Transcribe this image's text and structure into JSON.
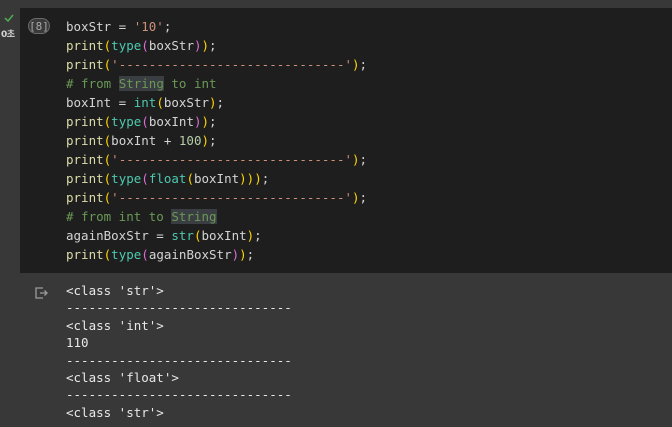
{
  "gutter": {
    "status_icon": "check-icon",
    "exec_time": "0초"
  },
  "cell": {
    "exec_count": "[8]"
  },
  "code_tokens": [
    [
      {
        "t": "boxStr = "
      },
      {
        "t": "'10'",
        "c": "tok-str"
      },
      {
        "t": ";"
      }
    ],
    [
      {
        "t": "print",
        "c": "tok-fn"
      },
      {
        "t": "(",
        "c": "tok-punc"
      },
      {
        "t": "type",
        "c": "tok-builtin"
      },
      {
        "t": "(",
        "c": "tok-punc2"
      },
      {
        "t": "boxStr"
      },
      {
        "t": ")",
        "c": "tok-punc2"
      },
      {
        "t": ")",
        "c": "tok-punc"
      },
      {
        "t": ";"
      }
    ],
    [
      {
        "t": "print",
        "c": "tok-fn"
      },
      {
        "t": "(",
        "c": "tok-punc"
      },
      {
        "t": "'------------------------------'",
        "c": "tok-str"
      },
      {
        "t": ")",
        "c": "tok-punc"
      },
      {
        "t": ";"
      }
    ],
    [
      {
        "t": "# from ",
        "c": "tok-comment"
      },
      {
        "t": "String",
        "c": "tok-comment tok-hl"
      },
      {
        "t": " to int",
        "c": "tok-comment"
      }
    ],
    [
      {
        "t": "boxInt = "
      },
      {
        "t": "int",
        "c": "tok-builtin"
      },
      {
        "t": "(",
        "c": "tok-punc"
      },
      {
        "t": "boxStr"
      },
      {
        "t": ")",
        "c": "tok-punc"
      },
      {
        "t": ";"
      }
    ],
    [
      {
        "t": "print",
        "c": "tok-fn"
      },
      {
        "t": "(",
        "c": "tok-punc"
      },
      {
        "t": "type",
        "c": "tok-builtin"
      },
      {
        "t": "(",
        "c": "tok-punc2"
      },
      {
        "t": "boxInt"
      },
      {
        "t": ")",
        "c": "tok-punc2"
      },
      {
        "t": ")",
        "c": "tok-punc"
      },
      {
        "t": ";"
      }
    ],
    [
      {
        "t": "print",
        "c": "tok-fn"
      },
      {
        "t": "(",
        "c": "tok-punc"
      },
      {
        "t": "boxInt + "
      },
      {
        "t": "100",
        "c": "tok-num"
      },
      {
        "t": ")",
        "c": "tok-punc"
      },
      {
        "t": ";"
      }
    ],
    [
      {
        "t": "print",
        "c": "tok-fn"
      },
      {
        "t": "(",
        "c": "tok-punc"
      },
      {
        "t": "'------------------------------'",
        "c": "tok-str"
      },
      {
        "t": ")",
        "c": "tok-punc"
      },
      {
        "t": ";"
      }
    ],
    [
      {
        "t": "print",
        "c": "tok-fn"
      },
      {
        "t": "(",
        "c": "tok-punc"
      },
      {
        "t": "type",
        "c": "tok-builtin"
      },
      {
        "t": "(",
        "c": "tok-punc2"
      },
      {
        "t": "float",
        "c": "tok-builtin"
      },
      {
        "t": "(",
        "c": "tok-punc"
      },
      {
        "t": "boxInt"
      },
      {
        "t": ")))",
        "c": "tok-punc"
      },
      {
        "t": ";"
      }
    ],
    [
      {
        "t": "print",
        "c": "tok-fn"
      },
      {
        "t": "(",
        "c": "tok-punc"
      },
      {
        "t": "'------------------------------'",
        "c": "tok-str"
      },
      {
        "t": ")",
        "c": "tok-punc"
      },
      {
        "t": ";"
      }
    ],
    [
      {
        "t": "# from int to ",
        "c": "tok-comment"
      },
      {
        "t": "String",
        "c": "tok-comment tok-hl"
      }
    ],
    [
      {
        "t": "againBoxStr = "
      },
      {
        "t": "str",
        "c": "tok-builtin"
      },
      {
        "t": "(",
        "c": "tok-punc"
      },
      {
        "t": "boxInt"
      },
      {
        "t": ")",
        "c": "tok-punc"
      },
      {
        "t": ";"
      }
    ],
    [
      {
        "t": "print",
        "c": "tok-fn"
      },
      {
        "t": "(",
        "c": "tok-punc"
      },
      {
        "t": "type",
        "c": "tok-builtin"
      },
      {
        "t": "(",
        "c": "tok-punc2"
      },
      {
        "t": "againBoxStr"
      },
      {
        "t": ")",
        "c": "tok-punc2"
      },
      {
        "t": ")",
        "c": "tok-punc"
      },
      {
        "t": ";"
      }
    ]
  ],
  "output": {
    "icon": "output-icon",
    "lines": [
      "<class 'str'>",
      "------------------------------",
      "<class 'int'>",
      "110",
      "------------------------------",
      "<class 'float'>",
      "------------------------------",
      "<class 'str'>"
    ]
  },
  "colors": {
    "page_bg": "#383838",
    "cell_bg": "#1e1e1e",
    "check": "#4caf50"
  }
}
